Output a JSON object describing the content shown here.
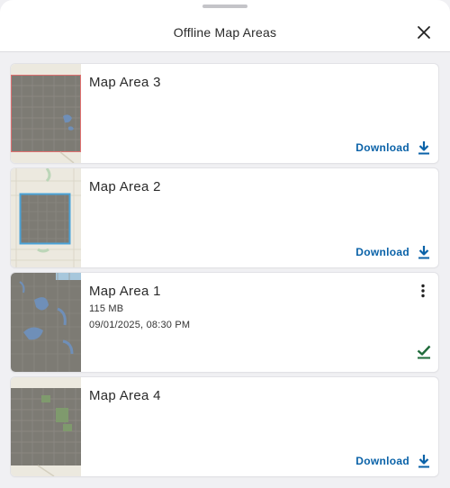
{
  "header": {
    "title": "Offline Map Areas",
    "close_icon": "close-icon"
  },
  "colors": {
    "accent": "#0a62a8",
    "downloaded": "#1f6b3a",
    "area_outline_red": "#e07070",
    "area_outline_blue": "#4aa3d8"
  },
  "map_areas": [
    {
      "name": "Map Area 3",
      "action_label": "Download",
      "action_icon": "download-icon"
    },
    {
      "name": "Map Area 2",
      "action_label": "Download",
      "action_icon": "download-icon"
    },
    {
      "name": "Map Area 1",
      "size": "115 MB",
      "date": "09/01/2025, 08:30 PM",
      "status_icon": "checkmark-icon",
      "menu_icon": "more-vertical-icon"
    },
    {
      "name": "Map Area 4",
      "action_label": "Download",
      "action_icon": "download-icon"
    }
  ]
}
